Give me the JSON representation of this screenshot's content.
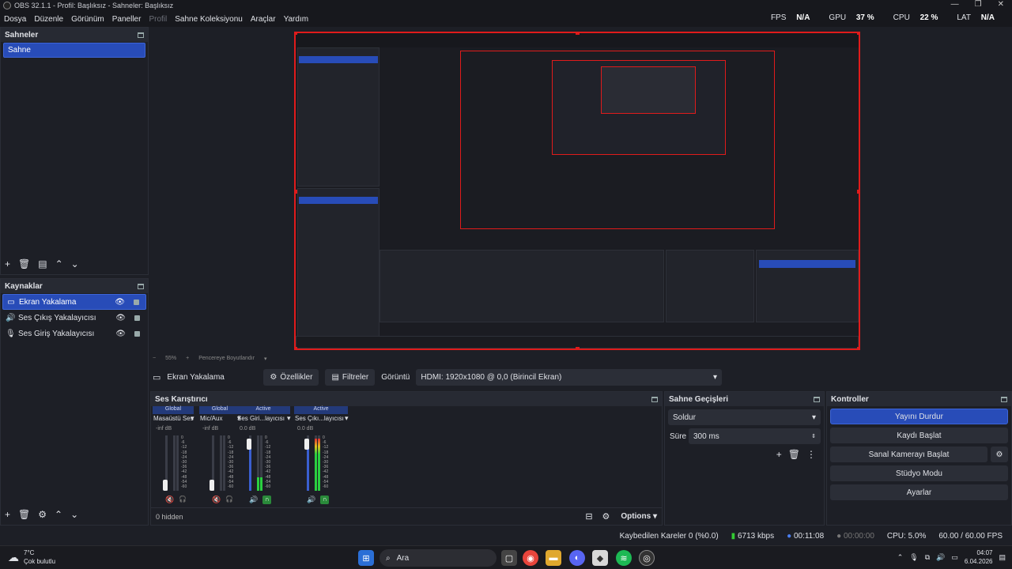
{
  "window": {
    "title": "OBS 32.1.1 - Profil: Başlıksız - Sahneler: Başlıksız",
    "controls": [
      "—",
      "❐",
      "✕"
    ]
  },
  "menu": {
    "items": [
      "Dosya",
      "Düzenle",
      "Görünüm",
      "Paneller",
      "Profil",
      "Sahne Koleksiyonu",
      "Araçlar",
      "Yardım"
    ]
  },
  "stats": {
    "fps_label": "FPS",
    "fps": "N/A",
    "gpu_label": "GPU",
    "gpu": "37 %",
    "cpu_label": "CPU",
    "cpu": "22 %",
    "lat_label": "LAT",
    "lat": "N/A"
  },
  "scenes": {
    "title": "Sahneler",
    "items": [
      "Sahne"
    ]
  },
  "sources": {
    "title": "Kaynaklar",
    "items": [
      {
        "label": "Ekran Yakalama",
        "icon": "monitor-icon"
      },
      {
        "label": "Ses Çıkış Yakalayıcısı",
        "icon": "speaker-icon"
      },
      {
        "label": "Ses Giriş Yakalayıcısı",
        "icon": "microphone-icon"
      }
    ]
  },
  "preview_bar": {
    "minus": "−",
    "zoom": "55%",
    "plus": "+",
    "mode": "Pencereye Boyutlandır"
  },
  "context": {
    "source": "Ekran Yakalama",
    "props": "Özellikler",
    "filters": "Filtreler",
    "display_label": "Görüntü",
    "display_value": "HDMI: 1920x1080 @ 0,0 (Birincil Ekran)"
  },
  "mixer": {
    "title": "Ses Karıştırıcı",
    "hidden": "0 hidden",
    "options": "Options",
    "scale": [
      "0",
      "-6",
      "-12",
      "-18",
      "-24",
      "-30",
      "-36",
      "-42",
      "-48",
      "-54",
      "-60"
    ],
    "channels": [
      {
        "head": "Global",
        "name": "Masaüstü Ses",
        "db": "-inf dB",
        "level": 0.0,
        "fader": 0.1,
        "muted": true
      },
      {
        "head": "Global",
        "name": "Mic/Aux",
        "db": "-inf dB",
        "level": 0.0,
        "fader": 0.1,
        "muted": true
      },
      {
        "head": "Active",
        "name": "Ses Giri...layıcısı",
        "db": "0.0 dB",
        "level": 0.25,
        "fader": 0.85,
        "muted": false
      },
      {
        "head": "Active",
        "name": "Ses Çıkı...layıcısı",
        "db": "0.0 dB",
        "level": 0.95,
        "fader": 0.85,
        "muted": false
      }
    ]
  },
  "transitions": {
    "title": "Sahne Geçişleri",
    "selected": "Soldur",
    "duration_label": "Süre",
    "duration": "300 ms"
  },
  "controls": {
    "title": "Kontroller",
    "stream": "Yayını Durdur",
    "record": "Kaydı Başlat",
    "vcam": "Sanal Kamerayı Başlat",
    "studio": "Stüdyo Modu",
    "settings": "Ayarlar"
  },
  "status": {
    "dropped": "Kaybedilen Kareler 0 (%0.0)",
    "bitrate": "6713 kbps",
    "stream_time": "00:11:08",
    "rec_time": "00:00:00",
    "cpu": "CPU: 5.0%",
    "fps": "60.00 / 60.00 FPS"
  },
  "taskbar": {
    "temp": "7°C",
    "weather": "Çok bulutlu",
    "search": "Ara",
    "time": "04:07",
    "date": "6.04.2026"
  }
}
